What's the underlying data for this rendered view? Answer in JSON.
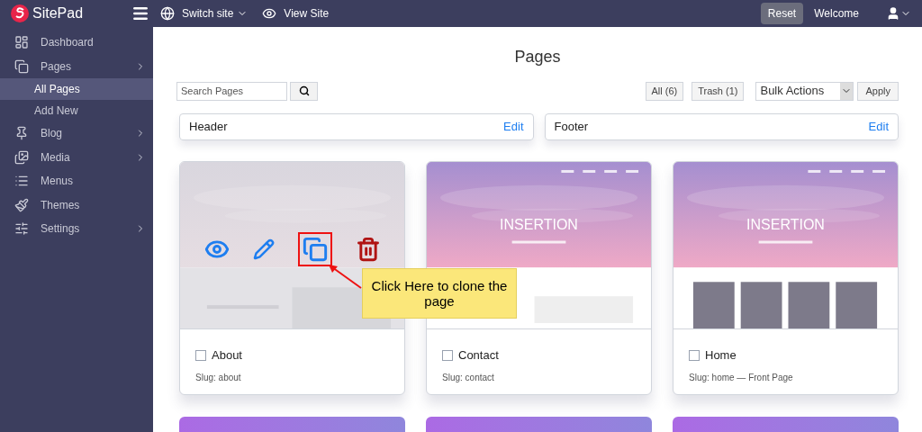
{
  "topbar": {
    "brand": "SitePad",
    "switch_site": "Switch site",
    "view_site": "View Site",
    "reset": "Reset",
    "welcome": "Welcome"
  },
  "sidebar": {
    "items": [
      {
        "label": "Dashboard",
        "has_arrow": false
      },
      {
        "label": "Pages",
        "has_arrow": true,
        "children": [
          {
            "label": "All Pages",
            "selected": true
          },
          {
            "label": "Add New",
            "selected": false
          }
        ]
      },
      {
        "label": "Blog",
        "has_arrow": true
      },
      {
        "label": "Media",
        "has_arrow": true
      },
      {
        "label": "Menus",
        "has_arrow": false
      },
      {
        "label": "Themes",
        "has_arrow": false
      },
      {
        "label": "Settings",
        "has_arrow": true
      }
    ]
  },
  "heading": "Pages",
  "search": {
    "placeholder": "Search Pages"
  },
  "filters": [
    "All (6)",
    "Trash (1)"
  ],
  "bulk_select": "Bulk Actions",
  "apply": "Apply",
  "sections": [
    {
      "label": "Header",
      "action": "Edit"
    },
    {
      "label": "Footer",
      "action": "Edit"
    }
  ],
  "pages": [
    {
      "title": "About",
      "slug": "Slug: about",
      "checked": false,
      "hovered": true
    },
    {
      "title": "Contact",
      "slug": "Slug: contact",
      "checked": false,
      "hovered": false,
      "preview_title": "INSERTION"
    },
    {
      "title": "Home",
      "slug": "Slug: home — Front Page",
      "checked": false,
      "hovered": false,
      "preview_title": "INSERTION",
      "kind": "albums"
    }
  ],
  "callout": "Click Here to clone the page"
}
